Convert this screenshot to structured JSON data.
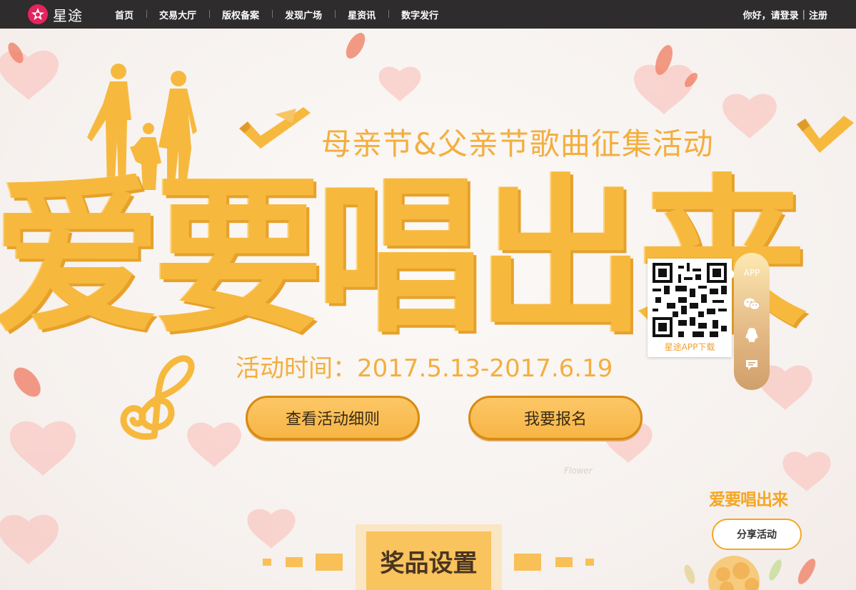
{
  "nav": {
    "brand": "星途",
    "items": [
      "首页",
      "交易大厅",
      "版权备案",
      "发现广场",
      "星资讯",
      "数字发行"
    ],
    "greeting": "你好，请登录",
    "separator": "|",
    "register": "注册"
  },
  "hero": {
    "subtitle": "母亲节&父亲节歌曲征集活动",
    "title": "爱要唱出来",
    "time": "活动时间：2017.5.13-2017.6.19",
    "rules_button": "查看活动细则",
    "signup_button": "我要报名",
    "watermark": "Flower"
  },
  "prize": {
    "heading": "奖品设置"
  },
  "sidebar": {
    "qr_caption": "星途APP下载",
    "app_label": "APP",
    "icons": [
      "wechat-icon",
      "qq-icon",
      "chat-icon"
    ]
  },
  "share": {
    "logo": "爱要唱出来",
    "button": "分享活动"
  },
  "colors": {
    "nav_bg": "#2e2c2d",
    "accent": "#f6b93e",
    "button_border": "#d78a12",
    "brand": "#e4245d"
  }
}
